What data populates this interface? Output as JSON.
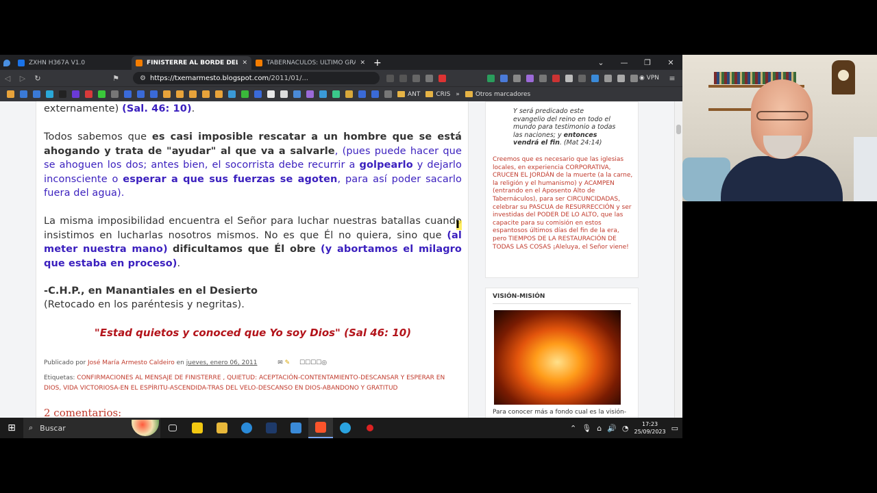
{
  "tabs": [
    {
      "label": "ZXHN H367A V1.0",
      "color": "#1a73e8"
    },
    {
      "label": "FINISTERRE AL BORDE DEL JORD",
      "color": "#f57d00"
    },
    {
      "label": "TABERNÁCULOS: ÚLTIMO GRAN AVIV",
      "color": "#f57d00"
    }
  ],
  "url": {
    "host": "https://txemarmesto.blogspot.com",
    "path": "/2011/01/..."
  },
  "vpn_label": "VPN",
  "bookmarks": {
    "ant": "ANT",
    "cris": "CRIS",
    "more": "»",
    "others": "Otros marcadores"
  },
  "post": {
    "p0_text": "externamente) ",
    "p0_ref": "(Sal. 46: 10)",
    "p0_end": ".",
    "p1_a": "Todos sabemos que ",
    "p1_b": "es casi imposible rescatar a un hombre que se está ahogando y trata de \"ayudar\" al que va a salvarle",
    "p1_c": ", (pues puede hacer que se ahoguen los dos; antes bien, el socorrista debe recurrir a ",
    "p1_d": "golpearlo",
    "p1_e": " y dejarlo inconsciente o ",
    "p1_f": "esperar a que sus fuerzas se agoten",
    "p1_g": ", para así poder sacarlo fuera del agua).",
    "p2_a": "La misma imposibilidad encuentra el Señor para luchar nuestras batallas cuando insistimos en lucharlas nosotros mismos. No es que Él no quiera, sino que ",
    "p2_b": "(al meter nuestra mano)",
    "p2_c": " ",
    "p2_d": "dificultamos que Él obre",
    "p2_e": " ",
    "p2_f": "(y abortamos el milagro que estaba en proceso)",
    "p2_g": ".",
    "author": "-C.H.P., en Manantiales en el Desierto",
    "note": "(Retocado en los paréntesis y negritas).",
    "quote": "\"Estad quietos y conoced que Yo soy Dios\" (Sal 46: 10)",
    "published_prefix": "Publicado por ",
    "author_link": "José María Armesto Caldeiro",
    "published_mid": " en ",
    "date": "jueves, enero 06, 2011",
    "labels_prefix": "Etiquetas: ",
    "labels": "CONFIRMACIONES AL MENSAJE DE FINISTERRE , QUIETUD: ACEPTACIÓN-CONTENTAMIENTO-DESCANSAR Y ESPERAR EN DIOS, VIDA VICTORIOSA-EN EL ESPÍRITU-ASCENDIDA-TRAS DEL VELO-DESCANSO EN DIOS-ABANDONO Y GRATITUD",
    "comments": "2 comentarios:"
  },
  "sidebar": {
    "verse_a": "Y será predicado este evangelio del reino en todo el mundo para testimonio a todas las naciones; y ",
    "verse_b": "entonces vendrá el fin",
    "verse_c": ". (Mat 24:14)",
    "red_text": "Creemos que es necesario que las iglesias locales, en experiencia CORPORATIVA, CRUCEN EL JORDÁN de la muerte (a la carne, la religión y el humanismo) y ACAMPEN (entrando en el Aposento Alto de Tabernáculos), para ser CIRCUNCIDADAS, celebrar su PASCUA de RESURRECCIÓN y ser investidas del PODER DE LO ALTO, que las capacite para su comisión en estos espantosos últimos días del fin de la era, pero TIEMPOS DE LA RESTAURACIÓN DE TODAS LAS COSAS ¡Aleluya, el Señor viene!",
    "vision_title": "VISIÓN-MISIÓN",
    "vision_caption": "Para conocer más a fondo cual es la visión-"
  },
  "taskbar": {
    "search": "Buscar",
    "time": "17:23",
    "date": "25/09/2023"
  }
}
